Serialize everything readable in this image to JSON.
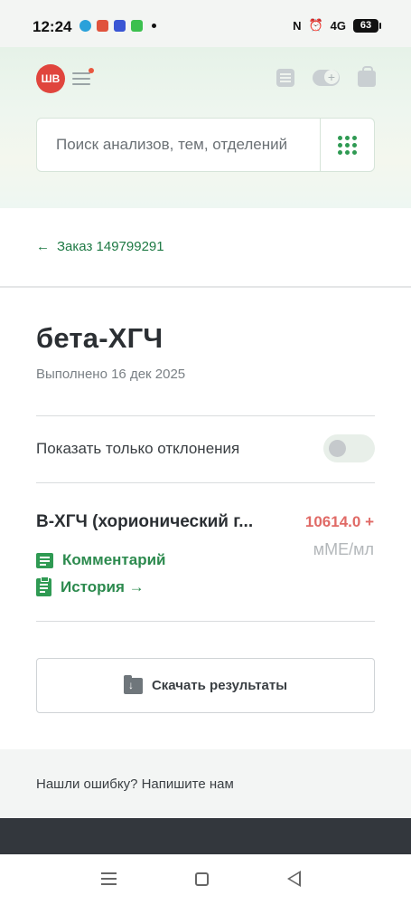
{
  "status_bar": {
    "time": "12:24",
    "network": "4G",
    "battery": "63"
  },
  "header": {
    "avatar_initials": "ШВ",
    "search": {
      "placeholder": "Поиск анализов, тем, отделений"
    }
  },
  "breadcrumb": {
    "back_label": "Заказ 149799291"
  },
  "main": {
    "title": "бета-ХГЧ",
    "completed": "Выполнено 16 дек 2025",
    "deviations_toggle_label": "Показать только отклонения",
    "deviations_toggle_on": false,
    "results": [
      {
        "name": "B-ХГЧ (хорионический гонадотропин человека)",
        "value": "10614.0 +",
        "unit": "мМЕ/мл",
        "comment_label": "Комментарий",
        "history_label": "История →"
      }
    ],
    "download_label": "Скачать результаты"
  },
  "feedback": {
    "text": "Нашли ошибку? Напишите нам"
  },
  "colors": {
    "accent_green": "#2c8a4e",
    "abnormal_value": "#e06a66",
    "avatar": "#e0453d"
  },
  "icons": [
    "menu-icon",
    "list-icon",
    "toggle-add-icon",
    "bag-icon",
    "grid-icon",
    "arrow-left-icon",
    "comment-icon",
    "clipboard-icon",
    "folder-download-icon"
  ]
}
